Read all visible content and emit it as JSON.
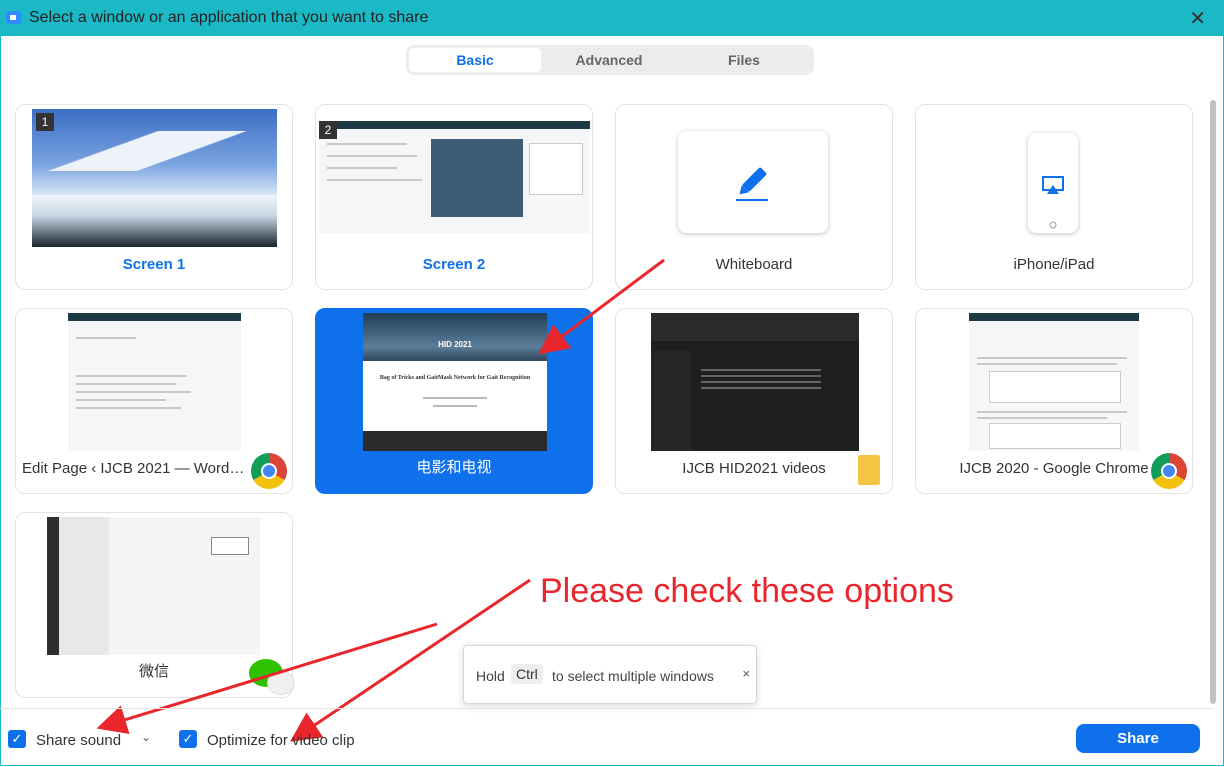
{
  "window": {
    "title": "Select a window or an application that you want to share"
  },
  "tabs": [
    {
      "label": "Basic",
      "active": true
    },
    {
      "label": "Advanced",
      "active": false
    },
    {
      "label": "Files",
      "active": false
    }
  ],
  "tiles": {
    "screen1": {
      "label": "Screen 1",
      "badge": "1"
    },
    "screen2": {
      "label": "Screen 2",
      "badge": "2"
    },
    "whiteboard": {
      "label": "Whiteboard"
    },
    "iphone": {
      "label": "iPhone/iPad"
    },
    "wordpress": {
      "label": "Edit Page ‹ IJCB 2021 — WordPre..."
    },
    "movies": {
      "label": "电影和电视",
      "selected": true,
      "thumb_header": "HID 2021",
      "thumb_title": "Bag of Tricks and GaitMask Network for Gait Recognition"
    },
    "videos": {
      "label": "IJCB HID2021 videos"
    },
    "chrome2020": {
      "label": "IJCB 2020 - Google Chrome"
    },
    "wechat": {
      "label": "微信"
    }
  },
  "tooltip": {
    "prefix": "Hold",
    "key": "Ctrl",
    "suffix": "to select multiple windows",
    "close": "×"
  },
  "options": {
    "share_sound": {
      "label": "Share sound",
      "checked": true
    },
    "optimize_video": {
      "label": "Optimize for video clip",
      "checked": true
    }
  },
  "share_button": {
    "label": "Share"
  },
  "annotation": {
    "text": "Please check these options"
  },
  "colors": {
    "accent": "#0e71eb",
    "titlebar": "#1bb8c5",
    "annotation": "#e8262b"
  }
}
